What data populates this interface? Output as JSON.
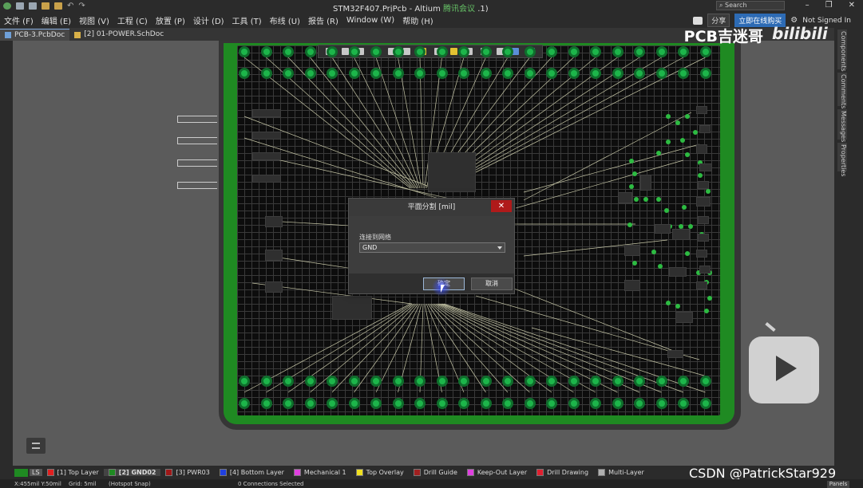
{
  "window": {
    "title": "STM32F407.PrjPcb - Altium",
    "title_suffix": "腾讯会议",
    "title_tail": ".1)",
    "search_placeholder": "Search",
    "min": "–",
    "restore": "❐",
    "close": "✕"
  },
  "menu": [
    "文件 (F)",
    "编辑 (E)",
    "视图 (V)",
    "工程 (C)",
    "放置 (P)",
    "设计 (D)",
    "工具 (T)",
    "布线 (U)",
    "报告 (R)",
    "Window (W)",
    "帮助 (H)"
  ],
  "topright": {
    "share": "分享",
    "buy": "立即在线购买",
    "signin": "Not Signed In"
  },
  "tabs": [
    {
      "label": "PCB-3.PcbDoc",
      "active": true
    },
    {
      "label": "[2] 01-POWER.SchDoc",
      "active": false
    }
  ],
  "right_panels": [
    "Components",
    "Comments",
    "Messages",
    "Properties"
  ],
  "watermark": {
    "top_text": "PCB吉迷哥",
    "logo": "bilibili"
  },
  "dialog": {
    "title": "平面分割 [mil]",
    "close": "✕",
    "label": "连接到网络",
    "net_value": "GND",
    "ok": "确定",
    "cancel": "取消"
  },
  "layers": [
    {
      "label": "[1] Top Layer",
      "color": "#e02020"
    },
    {
      "label": "[2] GND02",
      "color": "#1f8a22",
      "active": true
    },
    {
      "label": "[3] PWR03",
      "color": "#a01818"
    },
    {
      "label": "[4] Bottom Layer",
      "color": "#2040e0"
    },
    {
      "label": "Mechanical 1",
      "color": "#e040e0"
    },
    {
      "label": "Top Overlay",
      "color": "#f0e020"
    },
    {
      "label": "Drill Guide",
      "color": "#a02020"
    },
    {
      "label": "Keep-Out Layer",
      "color": "#e040e0"
    },
    {
      "label": "Drill Drawing",
      "color": "#e02030"
    },
    {
      "label": "Multi-Layer",
      "color": "#b0b0b0"
    }
  ],
  "ls_label": "LS",
  "status": {
    "coords": "X:455mil Y:50mil",
    "grid": "Grid: 5mil",
    "snap": "(Hotspot Snap)",
    "selected": "0 Connections Selected",
    "panels": "Panels"
  },
  "csdn": "CSDN @PatrickStar929"
}
